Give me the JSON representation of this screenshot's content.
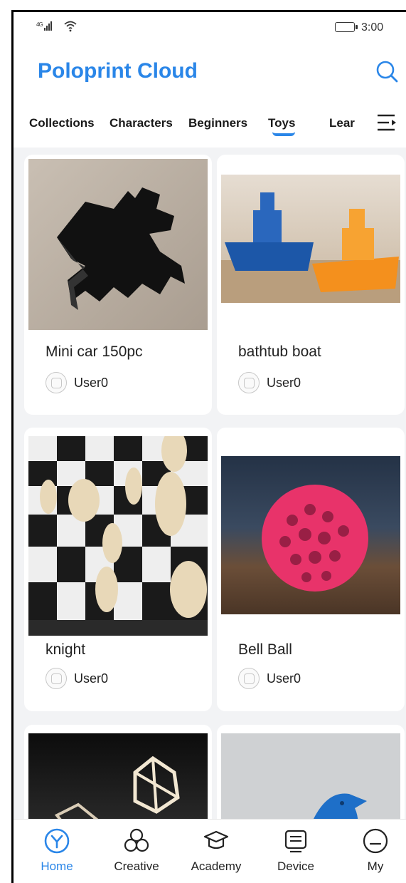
{
  "status_bar": {
    "signal": "4G",
    "time": "3:00"
  },
  "header": {
    "title": "Poloprint Cloud",
    "search_icon": "search-icon"
  },
  "tabs": [
    {
      "label": "Collections"
    },
    {
      "label": "Characters"
    },
    {
      "label": "Beginners"
    },
    {
      "label": "Toys",
      "active": true
    },
    {
      "label": "Lear"
    }
  ],
  "cards": [
    {
      "title": "Mini car 150pc",
      "user": "User0",
      "image": "black-3d-printed-frog"
    },
    {
      "title": "bathtub boat",
      "user": "User0",
      "image": "blue-and-orange-boats"
    },
    {
      "title": "knight",
      "user": "User0",
      "image": "chess-pieces"
    },
    {
      "title": "Bell Ball",
      "user": "User0",
      "image": "pink-lattice-ball"
    },
    {
      "title": "",
      "user": "",
      "image": "geometric-dice"
    },
    {
      "title": "",
      "user": "",
      "image": "blue-bird"
    }
  ],
  "bottom_nav": [
    {
      "label": "Home",
      "icon": "home-icon",
      "active": true
    },
    {
      "label": "Creative",
      "icon": "creative-icon"
    },
    {
      "label": "Academy",
      "icon": "academy-icon"
    },
    {
      "label": "Device",
      "icon": "device-icon"
    },
    {
      "label": "My",
      "icon": "my-icon"
    }
  ],
  "colors": {
    "accent": "#2a86e8",
    "background": "#f2f3f5"
  }
}
